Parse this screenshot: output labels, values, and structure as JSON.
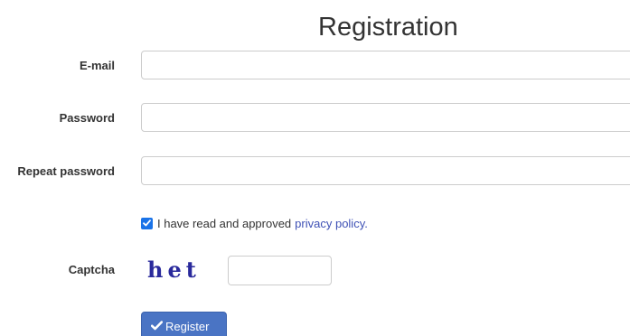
{
  "form": {
    "title": "Registration",
    "email_label": "E-mail",
    "email_value": "",
    "password_label": "Password",
    "password_value": "",
    "repeat_password_label": "Repeat password",
    "repeat_password_value": "",
    "agree_text": "I have read and approved",
    "privacy_link": "privacy policy.",
    "agree_checked": true,
    "captcha_label": "Captcha",
    "captcha_text": "het",
    "captcha_value": "",
    "register_label": "Register"
  },
  "colors": {
    "accent": "#4a74c4",
    "link": "#3f51b5",
    "checkbox": "#1a73e8",
    "captcha": "#2a2a9c"
  },
  "icons": {
    "checkbox": "checkbox-checked-icon",
    "register": "check-icon"
  }
}
